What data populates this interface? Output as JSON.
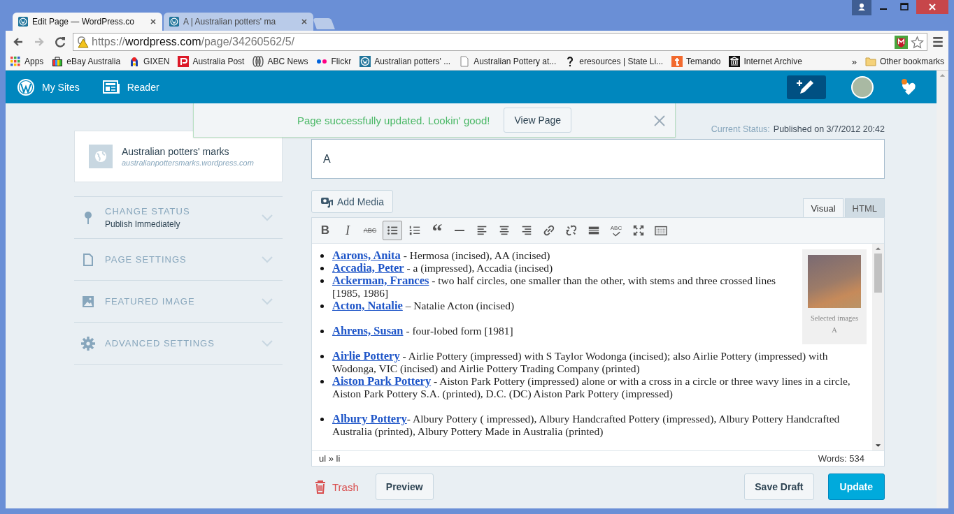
{
  "browser": {
    "tabs": [
      {
        "title": "Edit Page — WordPress.co",
        "selected": true
      },
      {
        "title": "A | Australian potters' ma",
        "selected": false
      }
    ],
    "address": {
      "scheme": "https://",
      "host": "wordpress.com",
      "path": "/page/34260562/5/"
    },
    "bookmarks": [
      {
        "kind": "apps",
        "label": "Apps"
      },
      {
        "kind": "bag",
        "label": "eBay Australia"
      },
      {
        "kind": "gixen",
        "label": "GIXEN"
      },
      {
        "kind": "post",
        "label": "Australia Post"
      },
      {
        "kind": "abc",
        "label": "ABC News"
      },
      {
        "kind": "dots",
        "label": "Flickr"
      },
      {
        "kind": "wp",
        "label": "Australian potters' ..."
      },
      {
        "kind": "page",
        "label": "Australian Pottery at..."
      },
      {
        "kind": "question",
        "label": "eresources | State Li..."
      },
      {
        "kind": "temando",
        "label": "Temando"
      },
      {
        "kind": "archive",
        "label": "Internet Archive"
      }
    ],
    "more": "»",
    "other": "Other bookmarks"
  },
  "masterbar": {
    "items": [
      {
        "kind": "wp",
        "label": "My Sites"
      },
      {
        "kind": "reader",
        "label": "Reader"
      }
    ]
  },
  "notice": {
    "message": "Page successfully updated. Lookin' good!",
    "action": "View Page"
  },
  "status": {
    "label": "Current Status:",
    "value": "Published on 3/7/2012 20:42"
  },
  "site": {
    "name": "Australian potters' marks",
    "url": "australianpottersmarks.wordpress.com"
  },
  "sections": [
    {
      "kind": "pin",
      "title": "CHANGE STATUS",
      "subtitle": "Publish Immediately"
    },
    {
      "kind": "page",
      "title": "PAGE SETTINGS"
    },
    {
      "kind": "image",
      "title": "FEATURED IMAGE"
    },
    {
      "kind": "gear",
      "title": "ADVANCED SETTINGS"
    }
  ],
  "title_value": "A",
  "add_media": "Add Media",
  "modes": [
    {
      "label": "Visual",
      "selected": true
    },
    {
      "label": "HTML",
      "selected": false
    }
  ],
  "toolbar": [
    {
      "kind": "bold",
      "glyph": "B",
      "selected": false
    },
    {
      "kind": "italic",
      "glyph": "I",
      "selected": false
    },
    {
      "kind": "strike",
      "glyph": "ABC",
      "selected": false
    },
    {
      "kind": "ul",
      "selected": true
    },
    {
      "kind": "ol",
      "selected": false
    },
    {
      "kind": "quote",
      "glyph": "“",
      "selected": false
    },
    {
      "kind": "hr",
      "selected": false
    },
    {
      "kind": "align-left",
      "selected": false
    },
    {
      "kind": "align-center",
      "selected": false
    },
    {
      "kind": "align-right",
      "selected": false
    },
    {
      "kind": "link",
      "selected": false
    },
    {
      "kind": "unlink",
      "selected": false
    },
    {
      "kind": "more",
      "selected": false
    },
    {
      "kind": "spell",
      "glyph": "ABC",
      "selected": false
    },
    {
      "kind": "fullscreen",
      "selected": false
    },
    {
      "kind": "keyboard",
      "selected": false
    }
  ],
  "lists": [
    [
      {
        "name": "Aarons, Anita",
        "text": " - Hermosa (incised), AA (incised)"
      },
      {
        "name": "Accadia, Peter",
        "text": " - a (impressed), Accadia (incised)"
      },
      {
        "name": "Ackerman, Frances",
        "text": " - two half circles, one smaller than the other, with stems and three crossed lines [1985, 1986]"
      },
      {
        "name": "Acton, Natalie",
        "text": " – Natalie Acton (incised)"
      }
    ],
    [
      {
        "name": "Ahrens, Susan",
        "text": " - four-lobed form [1981]"
      }
    ],
    [
      {
        "name": "Airlie Pottery",
        "text": " - Airlie Pottery (impressed) with S Taylor Wodonga (incised); also Airlie Pottery (impressed) with Wodonga, VIC (incised) and Airlie Pottery Trading Company (printed)"
      },
      {
        "name": "Aiston Park Pottery",
        "text": " - Aiston Park Pottery (impressed) alone or with a cross in a circle or three wavy lines in a circle, Aiston Park Pottery S.A. (printed), D.C. (DC) Aiston Park Pottery (impressed)"
      }
    ],
    [
      {
        "name": "Albury Pottery",
        "text": "- Albury Pottery ( impressed), Albury Handcrafted Pottery (impressed), Albury Pottery Handcrafted Australia (printed), Albury Pottery Made in Australia (printed)"
      }
    ]
  ],
  "gallery": {
    "caption": "Selected images",
    "title": "A"
  },
  "path": "ul » li",
  "words": "Words: 534",
  "actions": {
    "trash": "Trash",
    "preview": "Preview",
    "save": "Save Draft",
    "update": "Update"
  }
}
